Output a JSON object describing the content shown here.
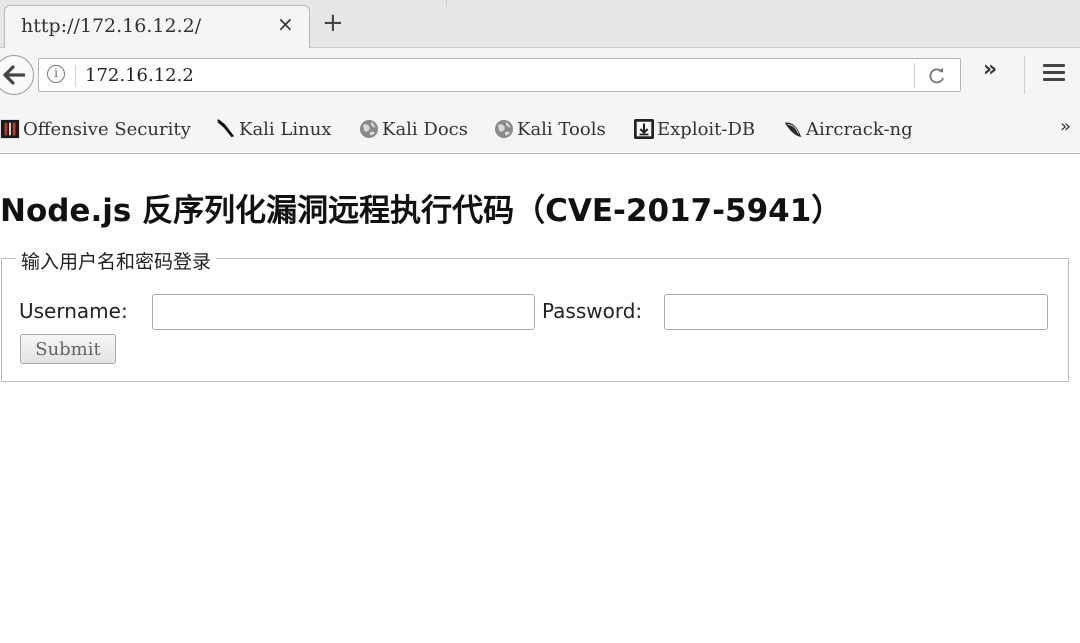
{
  "browser": {
    "tab": {
      "title": "http://172.16.12.2/",
      "close_glyph": "×"
    },
    "new_tab_glyph": "+",
    "url": "172.16.12.2",
    "info_glyph": "i",
    "overflow_glyph": "»",
    "bookmarks": [
      {
        "label": "Offensive Security",
        "icon": "offsec-icon"
      },
      {
        "label": "Kali Linux",
        "icon": "kali-dragon-icon"
      },
      {
        "label": "Kali Docs",
        "icon": "globe-icon"
      },
      {
        "label": "Kali Tools",
        "icon": "globe-icon"
      },
      {
        "label": "Exploit-DB",
        "icon": "exploit-db-icon"
      },
      {
        "label": "Aircrack-ng",
        "icon": "aircrack-icon"
      }
    ],
    "bookmarks_overflow_glyph": "»"
  },
  "page": {
    "title": "Node.js 反序列化漏洞远程执行代码（CVE-2017-5941）",
    "form": {
      "legend": "输入用户名和密码登录",
      "username_label": "Username:",
      "username_value": "",
      "password_label": "Password:",
      "password_value": "",
      "submit_label": "Submit"
    }
  }
}
